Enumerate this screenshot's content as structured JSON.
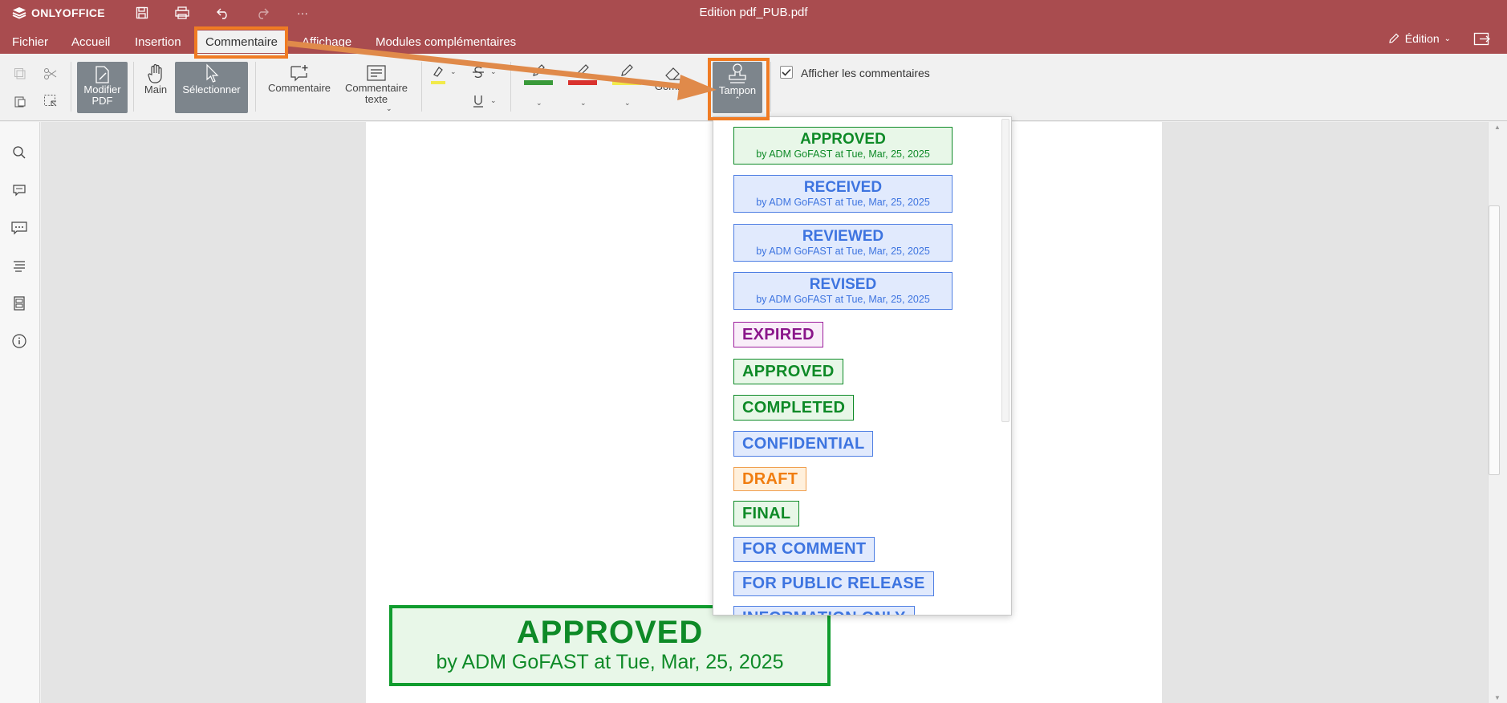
{
  "app": {
    "logo": "ONLYOFFICE",
    "title": "Edition pdf_PUB.pdf"
  },
  "menu": {
    "items": [
      "Fichier",
      "Accueil",
      "Insertion",
      "Commentaire",
      "Affichage",
      "Modules complémentaires"
    ],
    "active": "Commentaire",
    "mode_label": "Édition"
  },
  "toolbar": {
    "modify_pdf": "Modifier PDF",
    "hand": "Main",
    "select": "Sélectionner",
    "comment": "Commentaire",
    "text_comment": "Commentaire texte",
    "eraser": "Gomme",
    "stamp": "Tampon",
    "show_comments_label": "Afficher les commentaires",
    "show_comments_checked": true,
    "pen_colors": [
      "#3a9a3a",
      "#d9322e",
      "#f2ea4a"
    ],
    "highlight_color": "#f2ea4a"
  },
  "stamps": [
    {
      "title": "APPROVED",
      "sub": "by ADM GoFAST at Tue, Mar, 25, 2025",
      "style": "green"
    },
    {
      "title": "RECEIVED",
      "sub": "by ADM GoFAST at Tue, Mar, 25, 2025",
      "style": "blue"
    },
    {
      "title": "REVIEWED",
      "sub": "by ADM GoFAST at Tue, Mar, 25, 2025",
      "style": "blue"
    },
    {
      "title": "REVISED",
      "sub": "by ADM GoFAST at Tue, Mar, 25, 2025",
      "style": "blue"
    },
    {
      "title": "EXPIRED",
      "style": "purple"
    },
    {
      "title": "APPROVED",
      "style": "green"
    },
    {
      "title": "COMPLETED",
      "style": "green"
    },
    {
      "title": "CONFIDENTIAL",
      "style": "blue"
    },
    {
      "title": "DRAFT",
      "style": "orange"
    },
    {
      "title": "FINAL",
      "style": "green"
    },
    {
      "title": "FOR COMMENT",
      "style": "blue"
    },
    {
      "title": "FOR PUBLIC RELEASE",
      "style": "blue"
    },
    {
      "title": "INFORMATION ONLY",
      "style": "blue"
    }
  ],
  "placed_stamp": {
    "title": "APPROVED",
    "sub": "by ADM GoFAST at Tue, Mar, 25, 2025"
  },
  "annotation": {
    "color": "#f07b23"
  }
}
